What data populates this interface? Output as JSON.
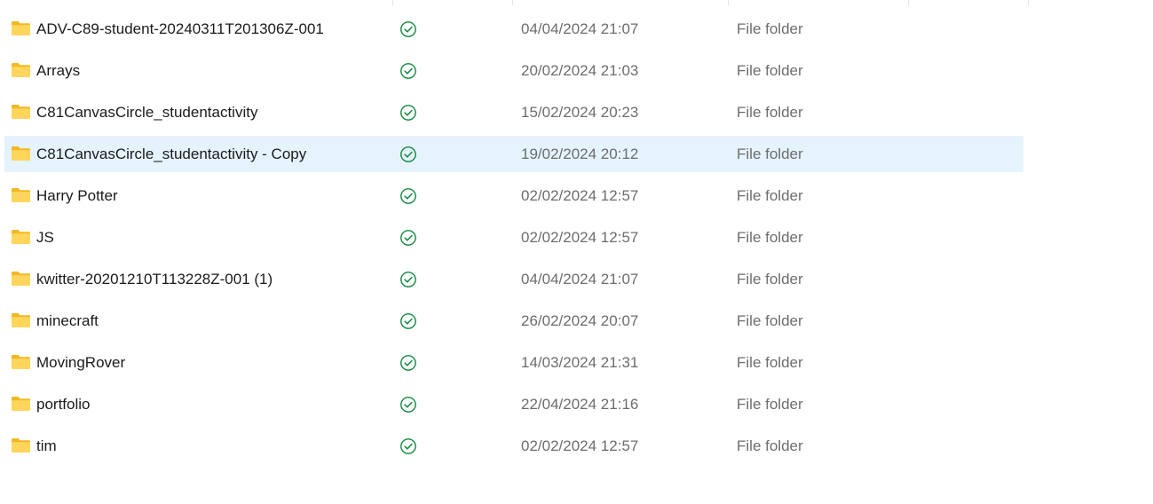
{
  "colors": {
    "folder_fill": "#FFD55C",
    "folder_tab": "#F2B824",
    "sync_ok": "#138A3E",
    "selected_row_bg": "#E5F3FD",
    "secondary_text": "#6D6D6D"
  },
  "files": [
    {
      "name": "ADV-C89-student-20240311T201306Z-001",
      "status_icon": "check-circle-icon",
      "date_modified": "04/04/2024 21:07",
      "type": "File folder",
      "selected": false
    },
    {
      "name": "Arrays",
      "status_icon": "check-circle-icon",
      "date_modified": "20/02/2024 21:03",
      "type": "File folder",
      "selected": false
    },
    {
      "name": "C81CanvasCircle_studentactivity",
      "status_icon": "check-circle-icon",
      "date_modified": "15/02/2024 20:23",
      "type": "File folder",
      "selected": false
    },
    {
      "name": "C81CanvasCircle_studentactivity - Copy",
      "status_icon": "check-circle-icon",
      "date_modified": "19/02/2024 20:12",
      "type": "File folder",
      "selected": true
    },
    {
      "name": "Harry Potter",
      "status_icon": "check-circle-icon",
      "date_modified": "02/02/2024 12:57",
      "type": "File folder",
      "selected": false
    },
    {
      "name": "JS",
      "status_icon": "check-circle-icon",
      "date_modified": "02/02/2024 12:57",
      "type": "File folder",
      "selected": false
    },
    {
      "name": "kwitter-20201210T113228Z-001 (1)",
      "status_icon": "check-circle-icon",
      "date_modified": "04/04/2024 21:07",
      "type": "File folder",
      "selected": false
    },
    {
      "name": "minecraft",
      "status_icon": "check-circle-icon",
      "date_modified": "26/02/2024 20:07",
      "type": "File folder",
      "selected": false
    },
    {
      "name": "MovingRover",
      "status_icon": "check-circle-icon",
      "date_modified": "14/03/2024 21:31",
      "type": "File folder",
      "selected": false
    },
    {
      "name": "portfolio",
      "status_icon": "check-circle-icon",
      "date_modified": "22/04/2024 21:16",
      "type": "File folder",
      "selected": false
    },
    {
      "name": "tim",
      "status_icon": "check-circle-icon",
      "date_modified": "02/02/2024 12:57",
      "type": "File folder",
      "selected": false
    }
  ]
}
